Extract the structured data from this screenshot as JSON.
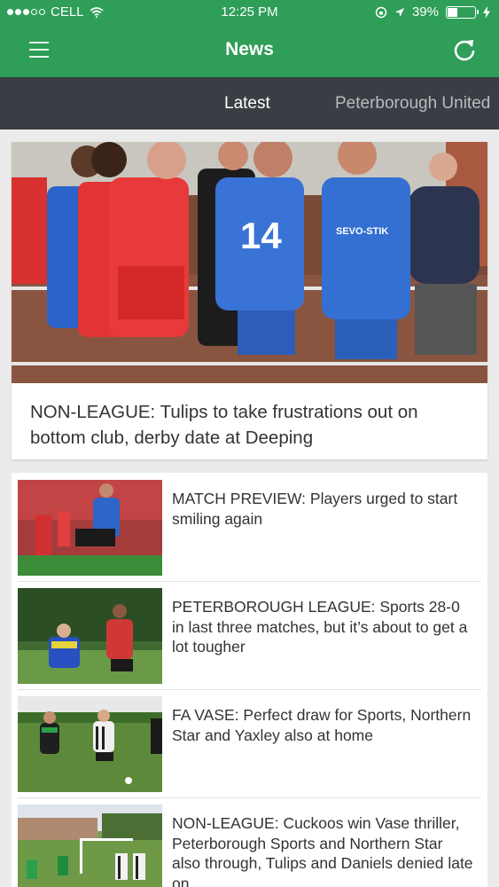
{
  "status_bar": {
    "carrier": "CELL",
    "time": "12:25 PM",
    "battery_percent": "39%",
    "battery_level": 0.39
  },
  "nav": {
    "title": "News",
    "menu_icon": "hamburger-menu-icon",
    "refresh_icon": "refresh-icon"
  },
  "tabs": [
    {
      "label": "Latest",
      "active": true
    },
    {
      "label": "Peterborough United"
    }
  ],
  "featured": {
    "title": "NON-LEAGUE: Tulips to take frustrations out on bottom club, derby date at Deeping"
  },
  "articles": [
    {
      "title": "MATCH PREVIEW: Players urged to start smiling again"
    },
    {
      "title": "PETERBOROUGH LEAGUE: Sports 28-0 in last three matches, but it’s about to get a lot tougher"
    },
    {
      "title": "FA VASE: Perfect draw for Sports, Northern Star and Yaxley also at home"
    },
    {
      "title": "NON-LEAGUE: Cuckoos win Vase thriller, Peterborough Sports and Northern Star also through, Tulips and Daniels denied late on"
    }
  ],
  "colors": {
    "brand_green": "#2e9e58",
    "tab_bar": "#3a3e44"
  },
  "photo_text": {
    "featured_number": "14",
    "featured_sponsor": "SEVO-STIK"
  }
}
